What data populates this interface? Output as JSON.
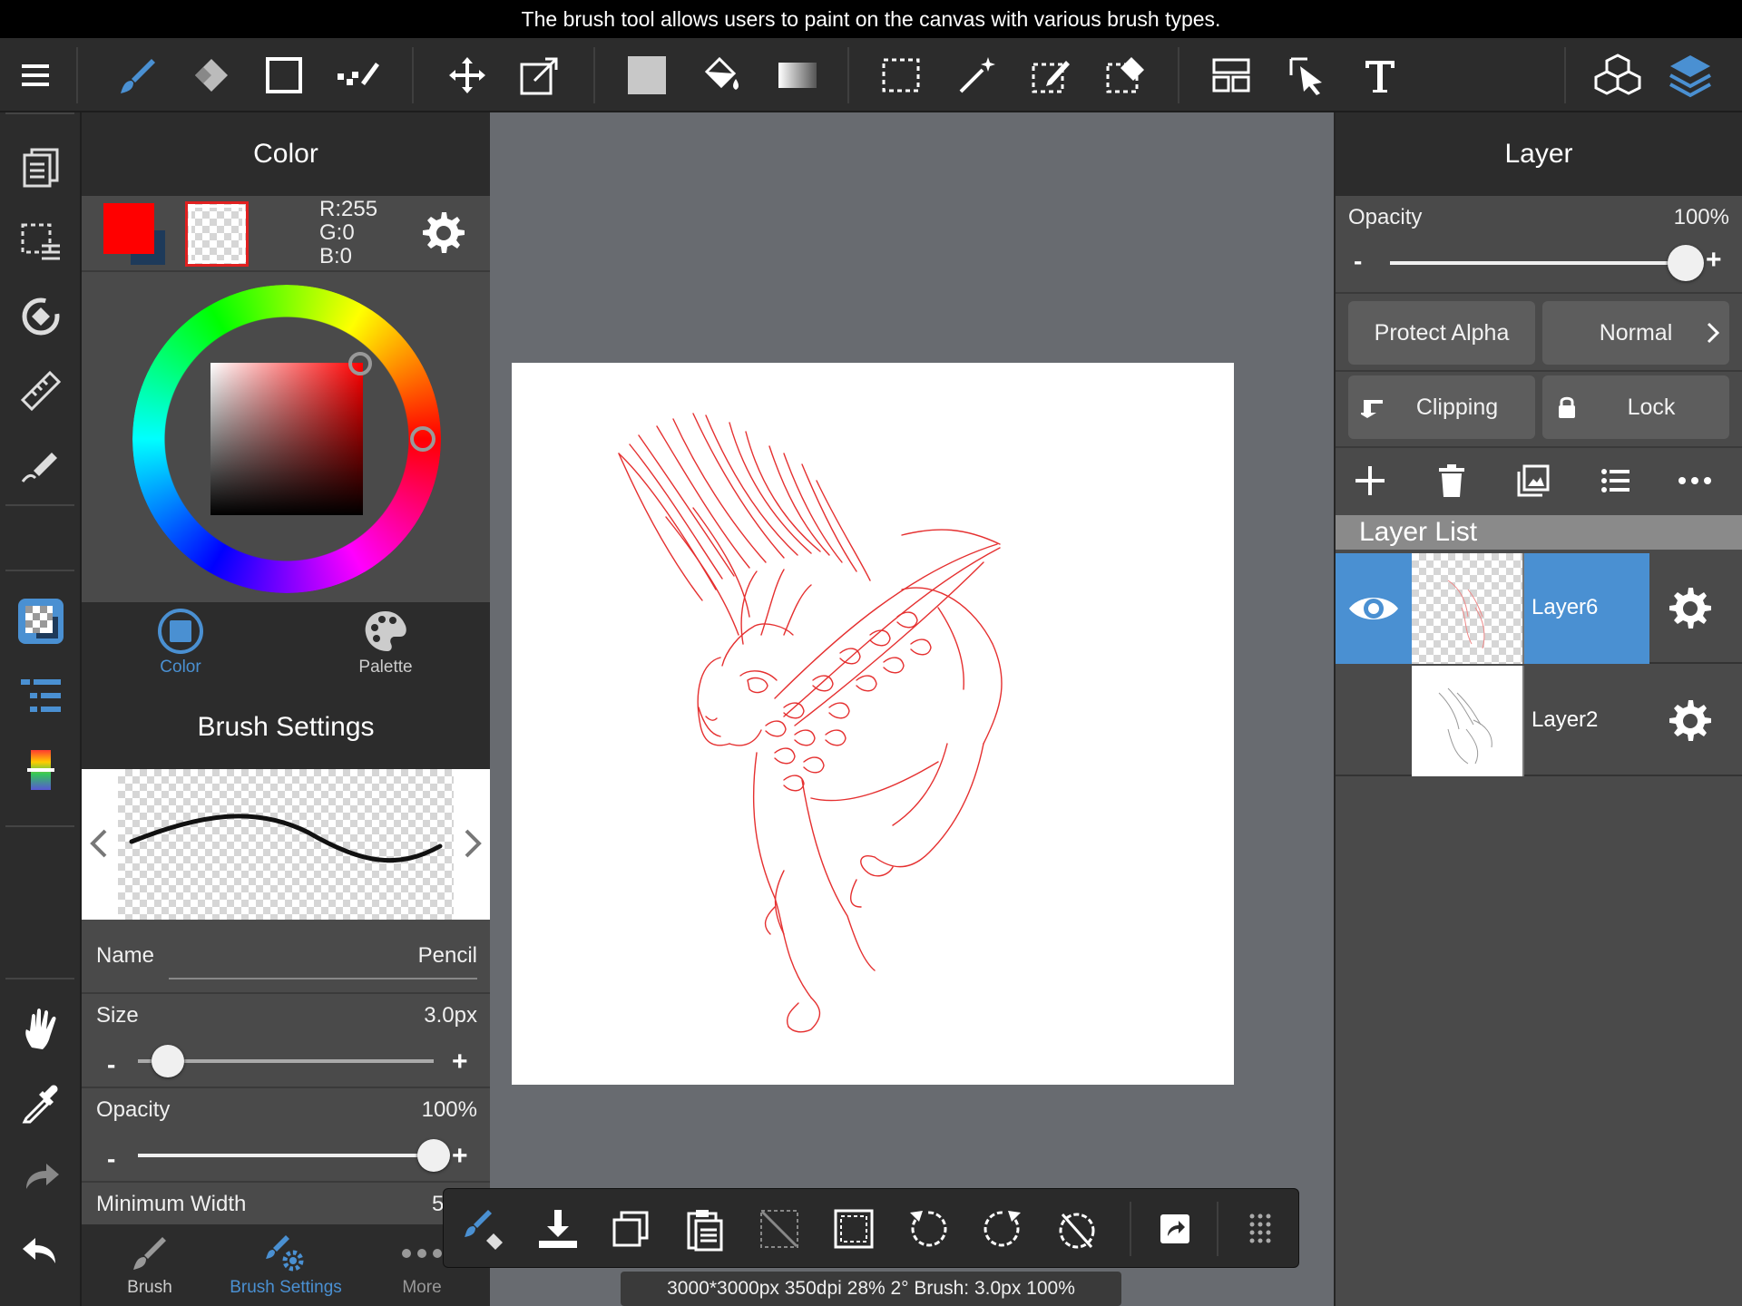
{
  "banner": "The brush tool allows users to paint on the canvas with various brush types.",
  "colors": {
    "accent": "#4a90d2",
    "primary": "#ff0000",
    "secondary": "#1e3a5a",
    "sketch": "#e53030"
  },
  "toolbar": {
    "tools": [
      "menu-icon",
      "brush-icon",
      "eraser-icon",
      "shape-icon",
      "dot-brush-icon",
      "move-icon",
      "transform-icon",
      "fill-color-icon",
      "bucket-icon",
      "gradient-icon",
      "select-rect-icon",
      "magic-wand-icon",
      "select-pen-icon",
      "select-eraser-icon",
      "frame-divide-icon",
      "select-object-icon",
      "text-icon",
      "3d-material-icon",
      "layers-icon"
    ]
  },
  "color_panel": {
    "title": "Color",
    "rgb_r": "R:255",
    "rgb_g": "G:0",
    "rgb_b": "B:0",
    "tab_color": "Color",
    "tab_palette": "Palette"
  },
  "brush_panel": {
    "title": "Brush Settings",
    "name_label": "Name",
    "name_value": "Pencil",
    "size_label": "Size",
    "size_value": "3.0px",
    "size_level": 0.1,
    "opacity_label": "Opacity",
    "opacity_value": "100%",
    "opacity_level": 1.0,
    "min_width_label": "Minimum Width",
    "min_width_value": "5",
    "minus": "-",
    "plus": "+",
    "tabs": [
      {
        "label": "Brush",
        "active": false
      },
      {
        "label": "Brush Settings",
        "active": true
      },
      {
        "label": "More",
        "active": false
      }
    ]
  },
  "layer_panel": {
    "title": "Layer",
    "opacity_label": "Opacity",
    "opacity_value": "100%",
    "opacity_level": 1.0,
    "minus": "-",
    "plus": "+",
    "protect_alpha": "Protect Alpha",
    "blend_mode": "Normal",
    "clipping": "Clipping",
    "lock": "Lock",
    "list_title": "Layer List",
    "layers": [
      {
        "name": "Layer6",
        "visible": true,
        "selected": true
      },
      {
        "name": "Layer2",
        "visible": false,
        "selected": false
      }
    ]
  },
  "status": "3000*3000px 350dpi 28% 2° Brush: 3.0px 100%"
}
